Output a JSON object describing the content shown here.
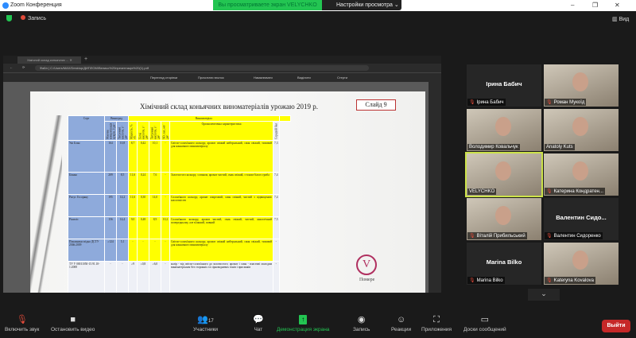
{
  "window": {
    "title": "Zoom Конференция",
    "min": "–",
    "max": "❐",
    "close": "✕"
  },
  "banner": {
    "text": "Вы просматриваете экран VELYCHKO",
    "settings": "Настройки просмотра"
  },
  "topbar": {
    "record": "Запись",
    "view": "Вид"
  },
  "browser": {
    "tab_title": "Хімічний склад коньячних ...",
    "url": "Файл | C:/Users/MAX/Desktop/ДИПЛОМ/Велико%20презентація%20(1).pdf",
    "toolbar": [
      "Перегляд сторінки",
      "Прочитати вголос",
      "Намалювати",
      "Виділити",
      "Стерти"
    ]
  },
  "slide": {
    "title": "Хімічний склад коньячних виноматеріалів урожаю 2019 р.",
    "number": "Слайд 9",
    "logo_text": "Помере Мо..."
  },
  "table": {
    "group_headers": {
      "sort": "Сорт",
      "grape": "Виноград",
      "wine": "Виноматеріал"
    },
    "columns": [
      "Масова концентрація цукрів, г/дм³",
      "Титровані кислоти, г/дм³",
      "Міцність, % об.",
      "Леткі кислоти, г/дм³",
      "Титровані кислоти, г/дм³",
      "SO₂ заг., мг/дм³",
      "Органолептична характеристика",
      "Середній бал"
    ],
    "rows": [
      {
        "sort": "Уні Блан",
        "values": [
          "164",
          "10,8",
          "8,7",
          "0,42",
          "10,1",
          "-"
        ],
        "desc": "Світло-солом'яного кольору, аромат свіжий нейтральний, смак свіжий, типовий для коньячного виноматеріалу",
        "score": "7,3"
      },
      {
        "sort": "Біанка",
        "values": [
          "209",
          "8,5",
          "11,6",
          "0,24",
          "7,6",
          "-"
        ],
        "desc": "Золотистого кольору, з оваком, аромат чистий, смак свіжий, з тоном білого гриба",
        "score": "7,4"
      },
      {
        "sort": "Рисус Госоряну",
        "values": [
          "195",
          "14,2",
          "11,6",
          "0,30",
          "14,0",
          "-"
        ],
        "desc": "Солом'яного кольору, аромат спиртовий, смак свіжий, чистий з підвищеною кислотністю",
        "score": "7,4"
      },
      {
        "sort": "Рішеліє",
        "values": [
          "156",
          "14,4",
          "9,0",
          "0,48",
          "8,9",
          "10,2"
        ],
        "desc": "Солом'яного кольору, аромат чистий, смак свіжий, чистий, аналогічний попередньому, але м'якший, повний",
        "score": "7,5"
      },
      {
        "sort": "Показники згідно ДСТУ 2366:2009",
        "values": [
          "≥124",
          "5,1",
          "-",
          "-",
          "-",
          "-"
        ],
        "desc": "Світло-солом'яного кольору, аромат свіжий нейтральний, смак свіжий, типовий для коньячного виноматеріалу",
        "score": "-"
      },
      {
        "sort": "ТУ У 00011050-15.91.10-1:2008",
        "values": [
          "-",
          "-",
          "≥9",
          "≤0,8",
          "≥6,0",
          "-"
        ],
        "desc": "колір - від світло-солом'яного до золотистого; аромат і смак - властиві молодим виноматеріалам без сторонніх та сірководневих тонів і присмаків",
        "score": "-"
      }
    ]
  },
  "participants": [
    {
      "name": "Ірина Бабич",
      "video": false,
      "muted": true
    },
    {
      "name": "Роман Мукоїд",
      "video": true,
      "muted": true
    },
    {
      "name": "Володимир Ковальчук",
      "video": true,
      "muted": false
    },
    {
      "name": "Anatoly Kuts",
      "video": true,
      "muted": false
    },
    {
      "name": "VELYCHKO",
      "video": true,
      "muted": false,
      "active": true
    },
    {
      "name": "Катерина Кондратен...",
      "video": true,
      "muted": true
    },
    {
      "name": "Віталій Прибильський",
      "video": true,
      "muted": true
    },
    {
      "name": "Валентин Сидоренко",
      "big_name": "Валентин  Сидо...",
      "video": false,
      "muted": true
    },
    {
      "name": "Marina Bilko",
      "video": false,
      "muted": true
    },
    {
      "name": "Kateryna Kovalova",
      "video": true,
      "muted": true
    }
  ],
  "bottombar": {
    "unmute": "Включить звук",
    "video": "Остановить видео",
    "participants": "Участники",
    "participants_count": "17",
    "chat": "Чат",
    "share": "Демонстрация экрана",
    "record": "Запись",
    "reactions": "Реакции",
    "apps": "Приложения",
    "whiteboards": "Доски сообщений",
    "leave": "Выйти"
  },
  "colors": {
    "share_green": "#23c552",
    "leave_red": "#c62828",
    "active_speaker": "#cde34a",
    "table_blue": "#8eaadb",
    "table_yellow": "#ffff00"
  }
}
